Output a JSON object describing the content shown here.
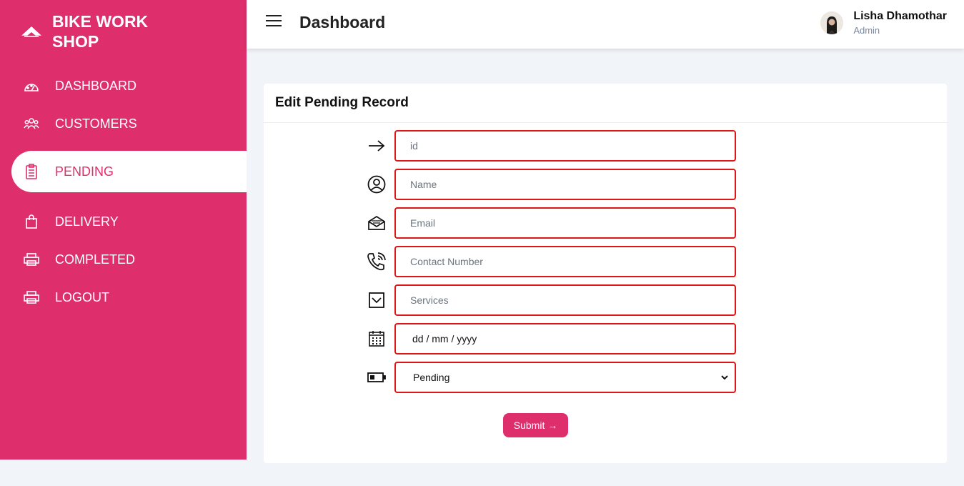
{
  "brand": {
    "name": "BIKE WORK SHOP",
    "icon": "bike-logo-icon"
  },
  "sidebar": {
    "items": [
      {
        "label": "DASHBOARD",
        "icon": "speedometer-icon",
        "active": false
      },
      {
        "label": "CUSTOMERS",
        "icon": "people-icon",
        "active": false
      },
      {
        "label": "PENDING",
        "icon": "clipboard-icon",
        "active": true
      },
      {
        "label": "DELIVERY",
        "icon": "bag-icon",
        "active": false
      },
      {
        "label": "COMPLETED",
        "icon": "printer-icon",
        "active": false
      },
      {
        "label": "LOGOUT",
        "icon": "printer-icon",
        "active": false
      }
    ]
  },
  "header": {
    "title": "Dashboard"
  },
  "user": {
    "name": "Lisha Dhamothar",
    "role": "Admin"
  },
  "form": {
    "title": "Edit Pending Record",
    "fields": {
      "id": {
        "placeholder": "id",
        "icon": "arrow-right-icon"
      },
      "name": {
        "placeholder": "Name",
        "icon": "person-circle-icon"
      },
      "email": {
        "placeholder": "Email",
        "icon": "envelope-open-icon"
      },
      "contact": {
        "placeholder": "Contact Number",
        "icon": "phone-vibrate-icon"
      },
      "services": {
        "placeholder": "Services",
        "icon": "chevron-down-square-icon"
      },
      "date": {
        "value": "dd / mm / yyyy",
        "icon": "calendar-icon"
      },
      "status": {
        "selected": "Pending",
        "icon": "battery-half-icon"
      }
    },
    "submit_label": "Submit →"
  },
  "colors": {
    "accent": "#de2f6c",
    "field_border": "#e01515",
    "background": "#f1f4f8"
  }
}
